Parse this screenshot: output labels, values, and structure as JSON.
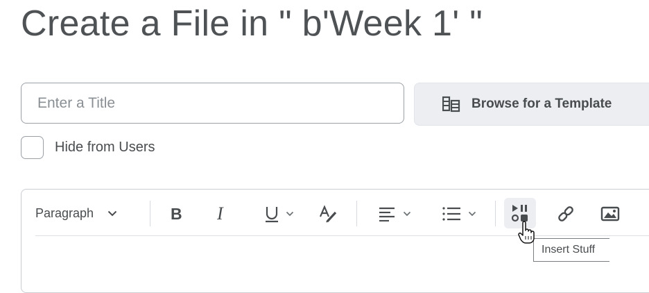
{
  "page": {
    "title": "Create a File in \" b'Week 1' \""
  },
  "form": {
    "title_placeholder": "Enter a Title",
    "title_value": "",
    "browse_template_label": "Browse for a Template",
    "hide_from_users_label": "Hide from Users",
    "hide_from_users_checked": false
  },
  "editor": {
    "block_format": "Paragraph",
    "toolbar": [
      {
        "name": "bold",
        "icon": "bold-icon"
      },
      {
        "name": "italic",
        "icon": "italic-icon"
      },
      {
        "name": "underline",
        "icon": "underline-icon",
        "has_menu": true
      },
      {
        "name": "text-styles",
        "icon": "text-style-icon"
      },
      {
        "name": "align",
        "icon": "align-left-icon",
        "has_menu": true
      },
      {
        "name": "list",
        "icon": "bulleted-list-icon",
        "has_menu": true
      },
      {
        "name": "insert-stuff",
        "icon": "insert-stuff-icon",
        "active": true
      },
      {
        "name": "link",
        "icon": "link-icon"
      },
      {
        "name": "image",
        "icon": "image-icon"
      }
    ],
    "tooltip": "Insert Stuff"
  }
}
